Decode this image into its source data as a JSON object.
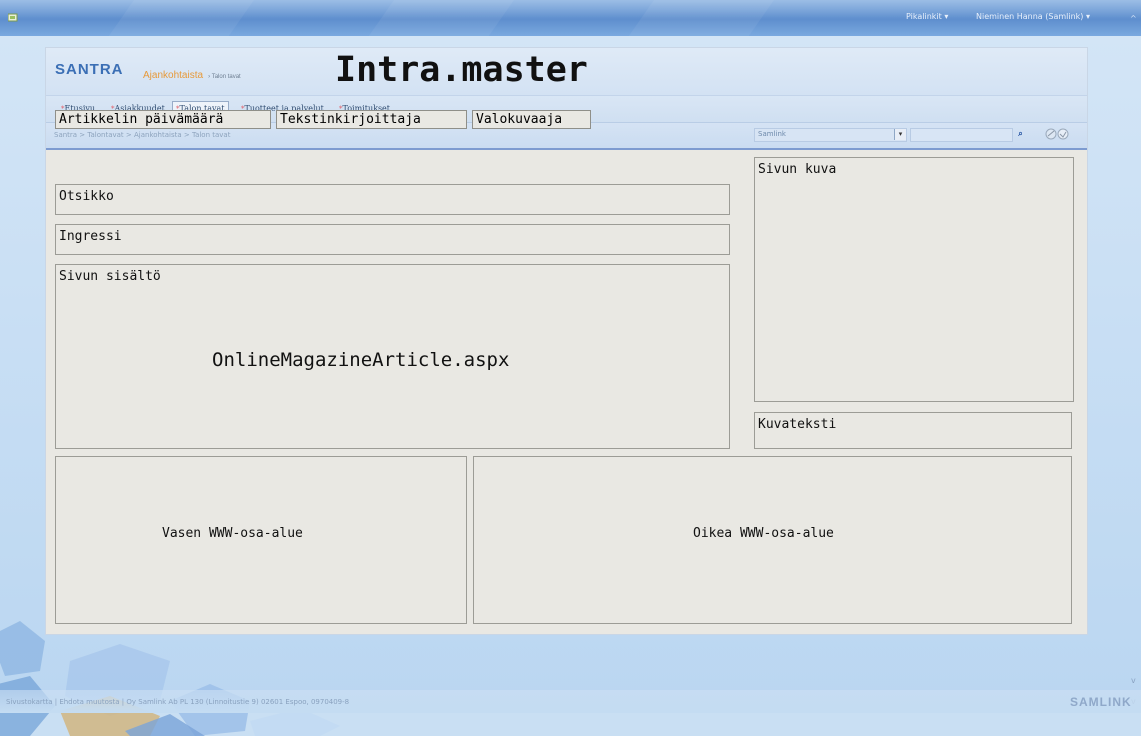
{
  "topbar": {
    "quick_links": "Pikalinkit ▾",
    "user": "Nieminen Hanna (Samlink) ▾"
  },
  "header": {
    "logo": "SANTRA",
    "section": "Ajankohtaista",
    "crumb_tail": "› Talon tavat",
    "master_title": "Intra.master"
  },
  "nav": {
    "items": [
      {
        "label": "Etusivu"
      },
      {
        "label": "Asiakkuudet"
      },
      {
        "label": "Talon tavat"
      },
      {
        "label": "Tuotteet ja palvelut"
      },
      {
        "label": "Toimitukset"
      }
    ]
  },
  "subbar": {
    "breadcrumb": "Santra > Talontavat > Ajankohtaista > Talon tavat",
    "scope": "Samlink",
    "search_value": ""
  },
  "placeholders": {
    "date": "Artikkelin päivämäärä",
    "writer": "Tekstinkirjoittaja",
    "photographer": "Valokuvaaja",
    "title": "Otsikko",
    "lead": "Ingressi",
    "content": "Sivun sisältö",
    "content_page": "OnlineMagazineArticle.aspx",
    "image": "Sivun kuva",
    "caption": "Kuvateksti",
    "left_zone": "Vasen WWW-osa-alue",
    "right_zone": "Oikea WWW-osa-alue"
  },
  "footer": {
    "links": "Sivustokartta  |  Ehdota muutosta  |  Oy Samlink Ab PL 130 (Linnoitustie 9) 02601 Espoo, 0970409-8",
    "logo": "SAMLINK"
  },
  "colors": {
    "topbar": "#6d9ad5",
    "logo": "#3b6fb5",
    "section": "#e79a3a",
    "accent_line": "#7d9bd0"
  }
}
